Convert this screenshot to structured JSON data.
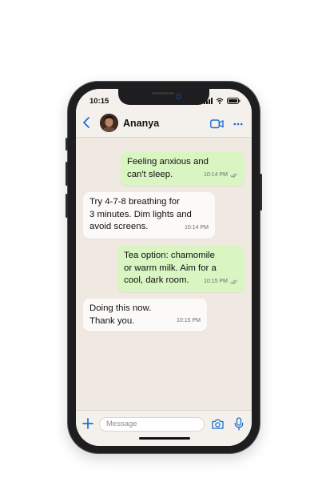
{
  "status": {
    "time": "10:15"
  },
  "header": {
    "contact_name": "Ananya"
  },
  "messages": [
    {
      "direction": "outgoing",
      "text": "Feeling anxious and\ncan't sleep.",
      "time": "10:14 PM",
      "read": true
    },
    {
      "direction": "incoming",
      "text": "Try 4-7-8 breathing for\n3 minutes. Dim lights and\navoid screens.",
      "time": "10:14 PM"
    },
    {
      "direction": "outgoing",
      "text": "Tea option: chamomile\nor warm milk. Aim for a\ncool, dark room.",
      "time": "10:15 PM",
      "read": true
    },
    {
      "direction": "incoming",
      "text": "Doing this now.\nThank you.",
      "time": "10:15 PM"
    }
  ],
  "composer": {
    "placeholder": "Message"
  },
  "colors": {
    "accent": "#1a6fd6",
    "outgoing_bubble": "#d8f5c2",
    "incoming_bubble": "#fbfaf8",
    "chat_bg": "#efe9e1"
  }
}
